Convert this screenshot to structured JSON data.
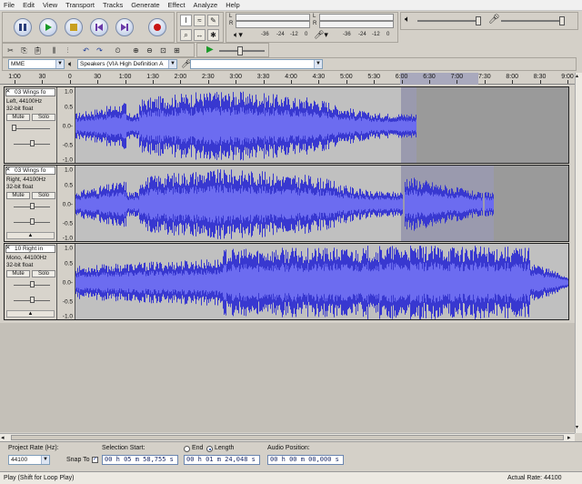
{
  "menu": [
    "File",
    "Edit",
    "View",
    "Transport",
    "Tracks",
    "Generate",
    "Effect",
    "Analyze",
    "Help"
  ],
  "meters": {
    "rec_scale": [
      "-36",
      "-24",
      "-12",
      "0"
    ],
    "play_scale": [
      "-36",
      "-24",
      "-12",
      "0"
    ],
    "L": "L",
    "R": "R"
  },
  "device": {
    "host": "MME",
    "output": "Speakers (VIA High Definition A",
    "input": ""
  },
  "ruler": {
    "ticks": [
      "1:00",
      "30",
      "0",
      "30",
      "1:00",
      "1:30",
      "2:00",
      "2:30",
      "3:00",
      "3:30",
      "4:00",
      "4:30",
      "5:00",
      "5:30",
      "6:00",
      "6:30",
      "7:00",
      "7:30",
      "8:00",
      "8:30",
      "9:00"
    ]
  },
  "tracks": [
    {
      "name": "03 Wings fo",
      "info1": "Left, 44100Hz",
      "info2": "32-bit float",
      "mute": "Mute",
      "solo": "Solo",
      "scale": [
        "1.0",
        "0.5",
        "0.0-",
        "-0.5",
        "-1.0"
      ]
    },
    {
      "name": "03 Wings fo",
      "info1": "Right, 44100Hz",
      "info2": "32-bit float",
      "mute": "Mute",
      "solo": "Solo",
      "scale": [
        "1.0",
        "0.5",
        "0.0-",
        "-0.5",
        "-1.0"
      ]
    },
    {
      "name": "10 Right in",
      "info1": "Mono, 44100Hz",
      "info2": "32-bit float",
      "mute": "Mute",
      "solo": "Solo",
      "scale": [
        "1.0",
        "0.5",
        "0.0-",
        "-0.5",
        "-1.0"
      ]
    }
  ],
  "selection_bar": {
    "project_rate_label": "Project Rate (Hz):",
    "project_rate": "44100",
    "snap_to": "Snap To",
    "selection_start_label": "Selection Start:",
    "end_label": "End",
    "length_label": "Length",
    "audio_position_label": "Audio Position:",
    "selection_start": "00 h 05 m 58,755 s",
    "length": "00 h 01 m 24,048 s",
    "audio_position": "00 h 00 m 00,000 s"
  },
  "status": {
    "left": "Play (Shift for Loop Play)",
    "right": "Actual Rate: 44100"
  },
  "colors": {
    "waveform": "#3838d0",
    "waveform_rms": "#6c6cf0",
    "track_bg": "#c0c0c0",
    "selected_bg": "#9a9aae"
  }
}
